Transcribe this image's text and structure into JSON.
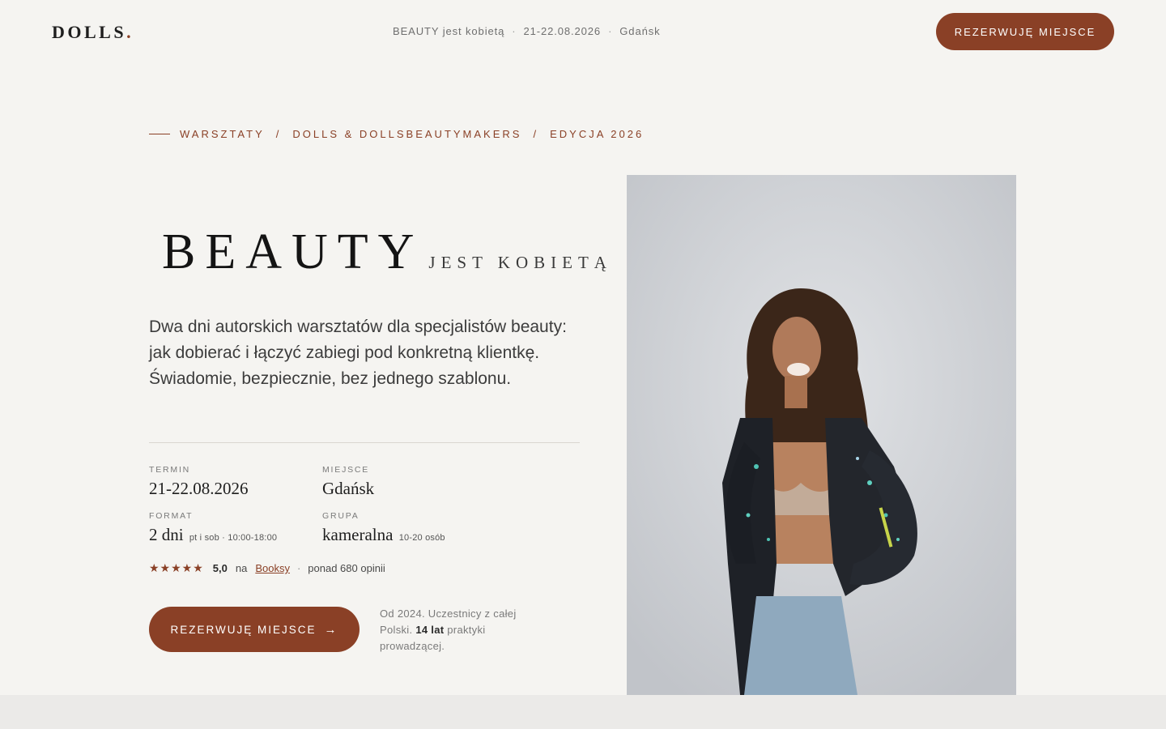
{
  "header": {
    "logo": "DOLLS",
    "logo_dot": ".",
    "event_name": "BEAUTY jest kobietą",
    "event_dates": "21-22.08.2026",
    "event_city": "Gdańsk",
    "separator": "·",
    "cta_label": "REZERWUJĘ MIEJSCE"
  },
  "breadcrumb": {
    "items": [
      "WARSZTATY",
      "DOLLS & DOLLSBEAUTYMAKERS",
      "EDYCJA 2026"
    ],
    "separator": "/"
  },
  "hero": {
    "title_big": "BEAUTY",
    "title_small": "JEST KOBIETĄ",
    "lead": "Dwa dni autorskich warsztatów dla specjalistów beauty: jak dobierać i łączyć zabiegi pod konkretną klientkę. Świadomie, bezpiecznie, bez jednego szablonu."
  },
  "details": {
    "termin_label": "TERMIN",
    "termin_value": "21-22.08.2026",
    "miejsce_label": "MIEJSCE",
    "miejsce_value": "Gdańsk",
    "format_label": "FORMAT",
    "format_value": "2 dni",
    "format_note": "pt i sob · 10:00-18:00",
    "grupa_label": "GRUPA",
    "grupa_value": "kameralna",
    "grupa_note": "10-20 osób"
  },
  "rating": {
    "stars": "★★★★★",
    "score": "5,0",
    "on": "na",
    "platform": "Booksy",
    "separator": "·",
    "reviews": "ponad 680 opinii"
  },
  "cta": {
    "label": "REZERWUJĘ MIEJSCE",
    "arrow": "→"
  },
  "side_note": {
    "part1": "Od 2024. Uczestnicy z całej Polski.",
    "years": "14 lat",
    "part2": "praktyki prowadzącej."
  },
  "colors": {
    "accent": "#8a4026",
    "background": "#f5f4f1",
    "text": "#2b2b2b"
  }
}
